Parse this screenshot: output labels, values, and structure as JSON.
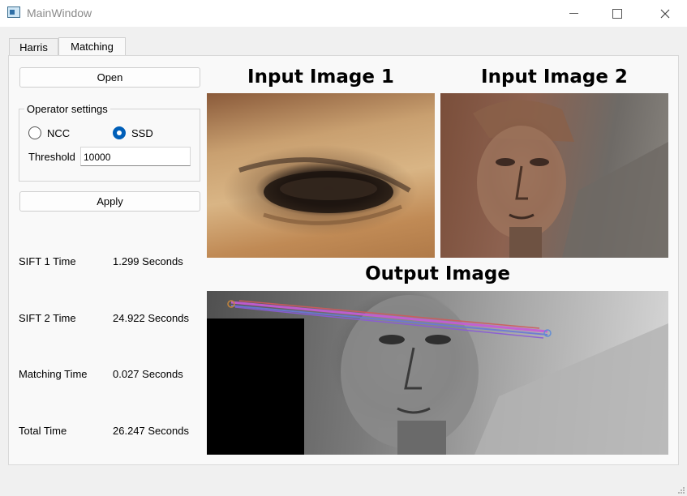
{
  "window": {
    "title": "MainWindow"
  },
  "tabs": [
    {
      "label": "Harris"
    },
    {
      "label": "Matching"
    }
  ],
  "controls": {
    "open_label": "Open",
    "apply_label": "Apply",
    "operator_group_title": "Operator settings",
    "radio_ncc_label": "NCC",
    "radio_ssd_label": "SSD",
    "selected_operator": "SSD",
    "threshold_label": "Threshold",
    "threshold_value": "10000"
  },
  "stats": [
    {
      "label": "SIFT 1 Time",
      "value": "1.299 Seconds"
    },
    {
      "label": "SIFT 2 Time",
      "value": "24.922 Seconds"
    },
    {
      "label": "Matching Time",
      "value": "0.027 Seconds"
    },
    {
      "label": "Total Time",
      "value": "26.247 Seconds"
    }
  ],
  "images": {
    "input1_title": "Input Image 1",
    "input2_title": "Input Image 2",
    "output_title": "Output Image"
  },
  "colors": {
    "radio_selected": "#005fb8"
  }
}
